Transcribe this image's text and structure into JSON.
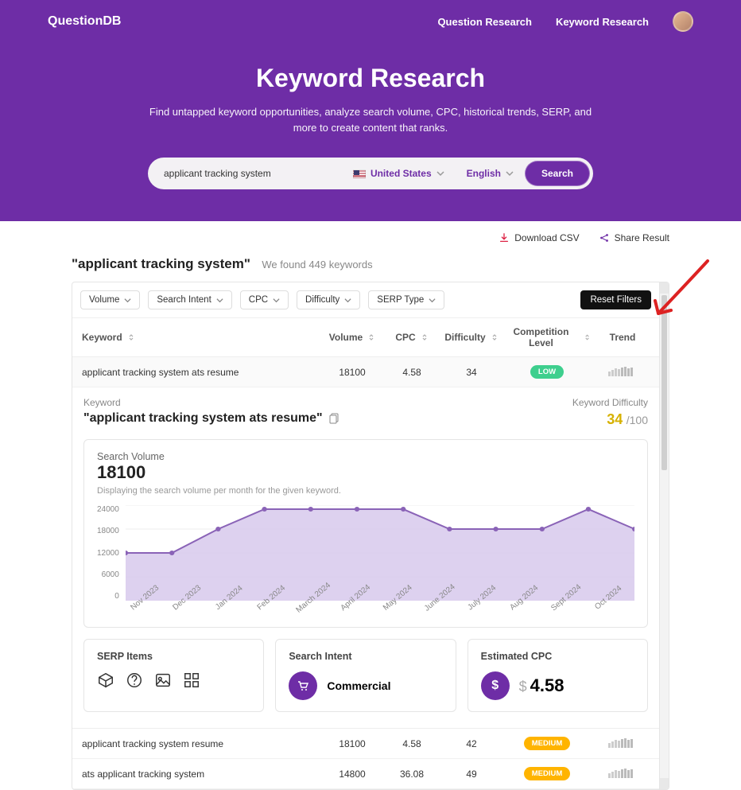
{
  "brand": "QuestionDB",
  "nav": {
    "research": "Question Research",
    "keyword": "Keyword Research"
  },
  "hero": {
    "title": "Keyword Research",
    "subtitle": "Find untapped keyword opportunities, analyze search volume, CPC, historical trends, SERP, and more to create content that ranks."
  },
  "search": {
    "value": "applicant tracking system",
    "country": "United States",
    "language": "English",
    "button": "Search"
  },
  "actions": {
    "download": "Download CSV",
    "share": "Share Result"
  },
  "results": {
    "query_display": "\"applicant tracking system\"",
    "found_text": "We found 449 keywords"
  },
  "filters": {
    "volume": "Volume",
    "intent": "Search Intent",
    "cpc": "CPC",
    "difficulty": "Difficulty",
    "serp": "SERP Type",
    "reset": "Reset Filters"
  },
  "columns": {
    "keyword": "Keyword",
    "volume": "Volume",
    "cpc": "CPC",
    "difficulty": "Difficulty",
    "competition": "Competition Level",
    "trend": "Trend"
  },
  "rows": [
    {
      "keyword": "applicant tracking system ats resume",
      "volume": "18100",
      "cpc": "4.58",
      "difficulty": "34",
      "competition": "LOW",
      "comp_level": "low",
      "expanded": true
    },
    {
      "keyword": "applicant tracking system resume",
      "volume": "18100",
      "cpc": "4.58",
      "difficulty": "42",
      "competition": "MEDIUM",
      "comp_level": "medium",
      "expanded": false
    },
    {
      "keyword": "ats applicant tracking system",
      "volume": "14800",
      "cpc": "36.08",
      "difficulty": "49",
      "competition": "MEDIUM",
      "comp_level": "medium",
      "expanded": false
    }
  ],
  "expanded": {
    "kw_label": "Keyword",
    "kw_value": "\"applicant tracking system ats resume\"",
    "kd_label": "Keyword Difficulty",
    "kd_value": "34",
    "kd_denominator": "/100",
    "sv_label": "Search Volume",
    "sv_value": "18100",
    "sv_desc": "Displaying the search volume per month for the given keyword.",
    "serp_label": "SERP Items",
    "intent_label": "Search Intent",
    "intent_value": "Commercial",
    "cpc_label": "Estimated CPC",
    "cpc_value": "4.58"
  },
  "chart_data": {
    "type": "area",
    "title": "Search Volume",
    "ylabel": "",
    "xlabel": "",
    "ylim": [
      0,
      24000
    ],
    "y_ticks": [
      24000,
      18000,
      12000,
      6000,
      0
    ],
    "categories": [
      "Nov 2023",
      "Dec 2023",
      "Jan 2024",
      "Feb 2024",
      "March 2024",
      "April 2024",
      "May 2024",
      "June 2024",
      "July 2024",
      "Aug 2024",
      "Sept 2024",
      "Oct 2024"
    ],
    "values": [
      12000,
      12000,
      18000,
      23000,
      23000,
      23000,
      23000,
      18000,
      18000,
      18000,
      23000,
      18000
    ]
  },
  "icons": {
    "serp_items": [
      "box-icon",
      "question-icon",
      "image-icon",
      "grid-icon"
    ]
  },
  "colors": {
    "brand": "#6e2da6",
    "chart_fill": "#d9cced",
    "chart_line": "#8a63b7",
    "low": "#3ecf8e",
    "medium": "#ffb400",
    "kd": "#d6b100"
  }
}
